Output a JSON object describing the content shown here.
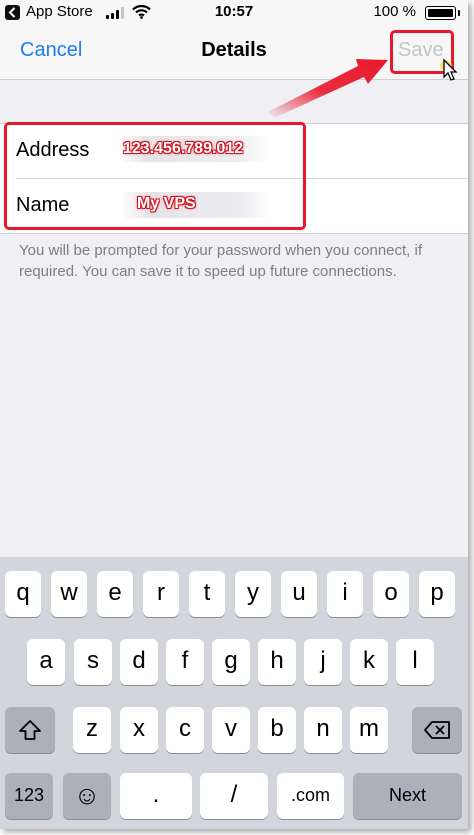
{
  "status_bar": {
    "back_app": "App Store",
    "time": "10:57",
    "battery": "100 %"
  },
  "nav": {
    "cancel": "Cancel",
    "title": "Details",
    "save": "Save"
  },
  "form": {
    "address_label": "Address",
    "address_value": "123.456.789.012",
    "name_label": "Name",
    "name_value": "My VPS"
  },
  "footnote": "You will be prompted for your password when you connect, if required. You can save it to speed up future connections.",
  "keyboard": {
    "row1": [
      "q",
      "w",
      "e",
      "r",
      "t",
      "y",
      "u",
      "i",
      "o",
      "p"
    ],
    "row2": [
      "a",
      "s",
      "d",
      "f",
      "g",
      "h",
      "j",
      "k",
      "l"
    ],
    "row3": [
      "z",
      "x",
      "c",
      "v",
      "b",
      "n",
      "m"
    ],
    "numbers_key": "123",
    "emoji_key": "☺",
    "period_key": ".",
    "slash_key": "/",
    "dotcom_key": ".com",
    "next_key": "Next",
    "icons": [
      "shift-icon",
      "backspace-icon",
      "emoji-icon",
      "back-icon",
      "wifi-icon",
      "battery-icon"
    ]
  },
  "colors": {
    "accent": "#1a7cf6",
    "annotation": "#e8182a",
    "disabled": "#c4c4c8"
  }
}
